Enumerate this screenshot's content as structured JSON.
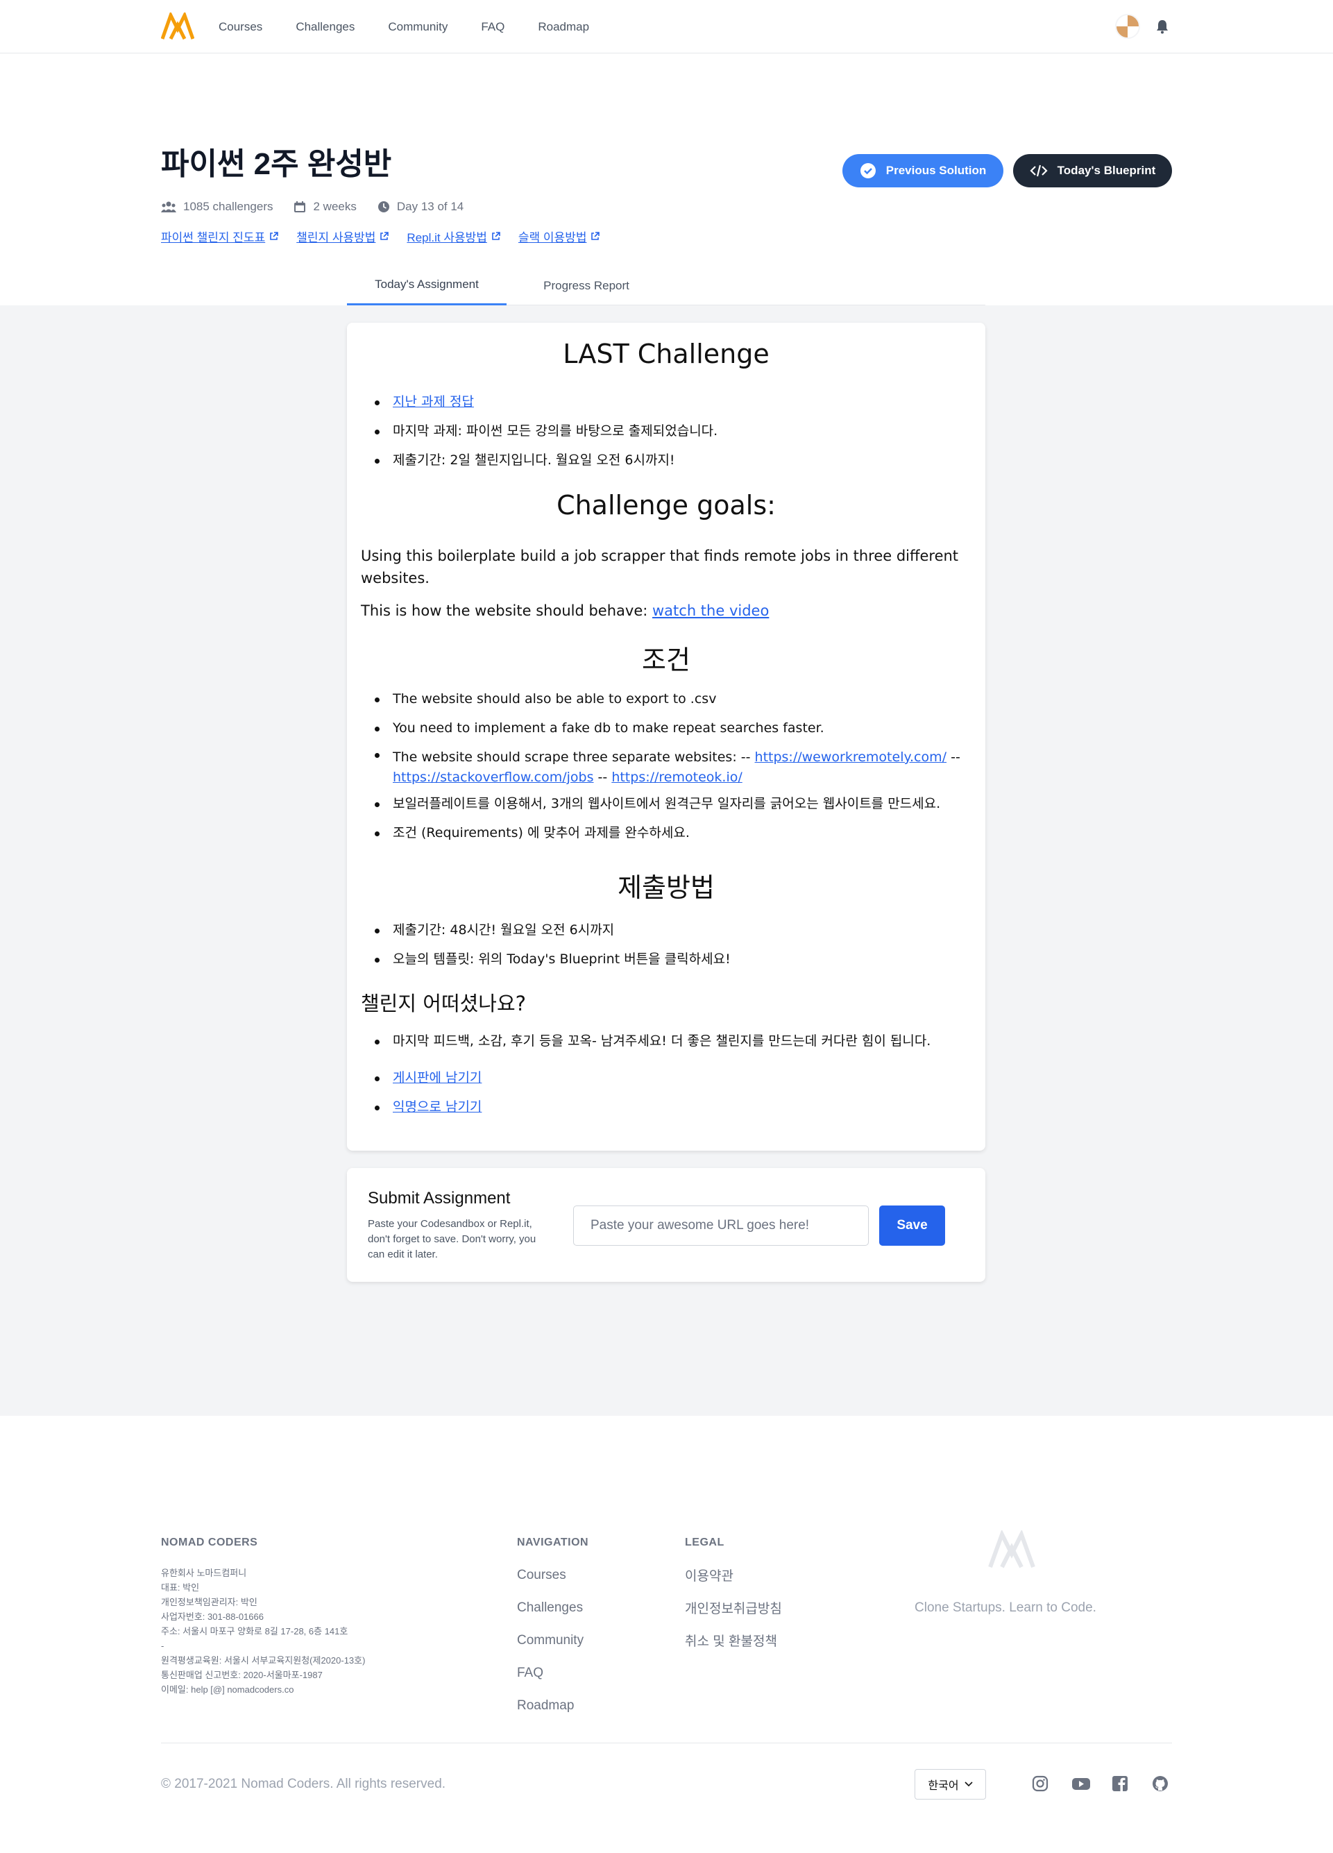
{
  "nav": {
    "links": [
      "Courses",
      "Challenges",
      "Community",
      "FAQ",
      "Roadmap"
    ]
  },
  "header": {
    "title": "파이썬 2주 완성반",
    "challengers": "1085 challengers",
    "duration": "2 weeks",
    "day": "Day 13 of 14",
    "links": [
      "파이썬 챌린지 진도표",
      "챌린지 사용방법",
      "Repl.it 사용방법",
      "슬랙 이용방법"
    ],
    "previous_solution": "Previous Solution",
    "todays_blueprint": "Today's Blueprint"
  },
  "tabs": [
    "Today's Assignment",
    "Progress Report"
  ],
  "assignment": {
    "title": "LAST Challenge",
    "intro_link": "지난 과제 정답",
    "intro_items": [
      "마지막 과제: 파이썬 모든 강의를 바탕으로 출제되었습니다.",
      "제출기간: 2일 챌린지입니다. 월요일 오전 6시까지!"
    ],
    "goals_title": "Challenge goals:",
    "goals_text": "Using this boilerplate build a job scrapper that finds remote jobs in three different websites.",
    "behave_text": "This is how the website should behave: ",
    "behave_link": "watch the video",
    "conditions_title": "조건",
    "conditions": [
      "The website should also be able to export to .csv",
      "You need to implement a fake db to make repeat searches faster."
    ],
    "scrape_text": "The website should scrape three separate websites: -- ",
    "scrape_link1": "https://weworkremotely.com/",
    "scrape_sep1": " -- ",
    "scrape_link2": "https://stackoverflow.com/jobs",
    "scrape_sep2": " -- ",
    "scrape_link3": "https://remoteok.io/",
    "conditions_after": [
      "보일러플레이트를 이용해서, 3개의 웹사이트에서 원격근무 일자리를 긁어오는 웹사이트를 만드세요.",
      "조건 (Requirements) 에 맞추어 과제를 완수하세요."
    ],
    "submit_title": "제출방법",
    "submit_items": [
      "제출기간: 48시간! 월요일 오전 6시까지",
      "오늘의 템플릿: 위의 Today's Blueprint 버튼을 클릭하세요!"
    ],
    "feedback_title": "챌린지 어떠셨나요?",
    "feedback_text": "마지막 피드백, 소감, 후기 등을 꼬옥- 남겨주세요! 더 좋은 챌린지를 만드는데 커다란 힘이 됩니다.",
    "feedback_links": [
      "게시판에 남기기",
      "익명으로 남기기"
    ]
  },
  "submit": {
    "title": "Submit Assignment",
    "desc": "Paste your Codesandbox or Repl.it, don't forget to save. Don't worry, you can edit it later.",
    "placeholder": "Paste your awesome URL goes here!",
    "save": "Save"
  },
  "footer": {
    "brand": "NOMAD CODERS",
    "info": [
      "유한회사 노마드컴퍼니",
      "대표: 박인",
      "개인정보책임관리자: 박인",
      "사업자번호: 301-88-01666",
      "주소: 서울시 마포구 양화로 8길 17-28, 6층 141호",
      "-",
      "원격평생교육원: 서울시 서부교육지원청(제2020-13호)",
      "통신판매업 신고번호: 2020-서울마포-1987",
      "이메일: help [@] nomadcoders.co"
    ],
    "nav_title": "NAVIGATION",
    "nav_links": [
      "Courses",
      "Challenges",
      "Community",
      "FAQ",
      "Roadmap"
    ],
    "legal_title": "LEGAL",
    "legal_links": [
      "이용약관",
      "개인정보취급방침",
      "취소 및 환불정책"
    ],
    "tagline": "Clone Startups. Learn to Code.",
    "copyright": "© 2017-2021 Nomad Coders. All rights reserved.",
    "language": "한국어"
  },
  "colors": {
    "accent_blue": "#3b82f6",
    "save_blue": "#2563eb",
    "dark_button": "#1f2937",
    "logo_orange": "#f59e0b"
  }
}
